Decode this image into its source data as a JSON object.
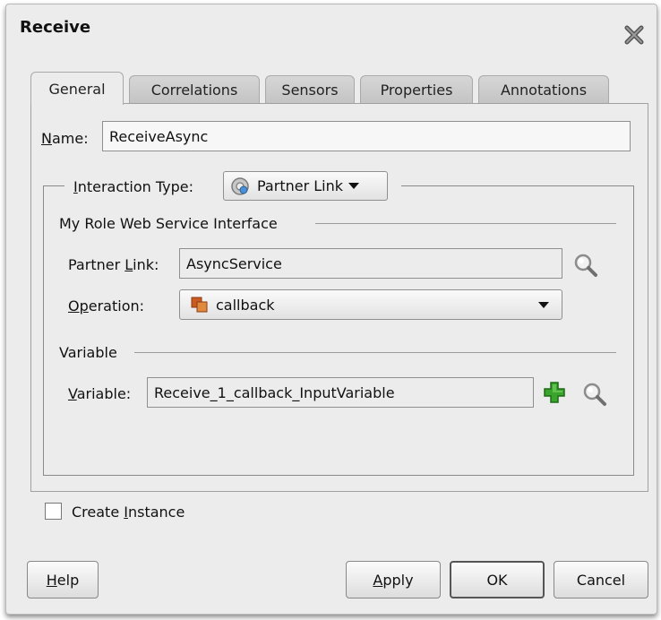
{
  "dialog": {
    "title": "Receive"
  },
  "tabs": [
    {
      "label": "General",
      "active": true
    },
    {
      "label": "Correlations",
      "active": false
    },
    {
      "label": "Sensors",
      "active": false
    },
    {
      "label": "Properties",
      "active": false
    },
    {
      "label": "Annotations",
      "active": false
    }
  ],
  "general": {
    "name_label_pre": "N",
    "name_label_post": "ame:",
    "name_value": "ReceiveAsync",
    "interaction_label_pre": "I",
    "interaction_label_post": "nteraction Type:",
    "interaction_value": "Partner Link",
    "my_role_section": "My Role Web Service Interface",
    "partner_link_label_pre": "Partner ",
    "partner_link_label_u": "L",
    "partner_link_label_post": "ink:",
    "partner_link_value": "AsyncService",
    "operation_label_pre": "O",
    "operation_label_u": "p",
    "operation_label_post": "eration:",
    "operation_value": "callback",
    "variable_section": "Variable",
    "variable_label_pre": "V",
    "variable_label_post": "ariable:",
    "variable_value": "Receive_1_callback_InputVariable",
    "create_instance_pre": "Create ",
    "create_instance_u": "I",
    "create_instance_post": "nstance",
    "create_instance_checked": false
  },
  "buttons": {
    "help_u": "H",
    "help_post": "elp",
    "apply_u": "A",
    "apply_post": "pply",
    "ok": "OK",
    "cancel": "Cancel"
  },
  "icons": {
    "close": "close-x-icon",
    "partner_link": "gear-globe-icon",
    "operation": "operation-icon",
    "search": "magnifier-icon",
    "add": "green-plus-icon"
  }
}
